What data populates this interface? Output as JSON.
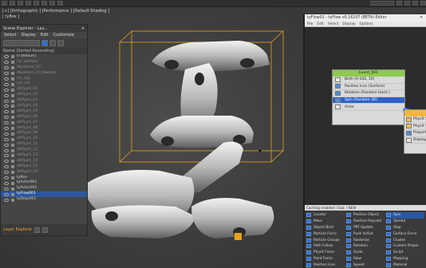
{
  "viewport": {
    "label": "[+] [Orthographic ] [Performance ] [Default Shading ]",
    "sublabel": "[ tyBox ]"
  },
  "scene_explorer": {
    "title": "Scene Explorer - Lay...",
    "menu": [
      "Select",
      "Display",
      "Edit",
      "Customize"
    ],
    "sort_label": "Name (Sorted Ascending)",
    "items": [
      {
        "label": "0 (default)",
        "state": "normal"
      },
      {
        "label": "car_bottom",
        "state": "dim"
      },
      {
        "label": "dbytelom_03",
        "state": "dim"
      },
      {
        "label": "dbytelom_03_blanket",
        "state": "dim"
      },
      {
        "label": "car_top",
        "state": "dim"
      },
      {
        "label": "car_obj",
        "state": "dim"
      },
      {
        "label": "dbflyprt_01",
        "state": "dim"
      },
      {
        "label": "dbflyprt_02",
        "state": "dim"
      },
      {
        "label": "dbflyprt_03",
        "state": "dim"
      },
      {
        "label": "dbflyprt_04",
        "state": "dim"
      },
      {
        "label": "dbflyprt_05",
        "state": "dim"
      },
      {
        "label": "dbflyprt_06",
        "state": "dim"
      },
      {
        "label": "dbflyprt_07",
        "state": "dim"
      },
      {
        "label": "dbflyprt_08",
        "state": "dim"
      },
      {
        "label": "dbflyprt_09",
        "state": "dim"
      },
      {
        "label": "dbflyprt_10",
        "state": "dim"
      },
      {
        "label": "dbflyprt_11",
        "state": "dim"
      },
      {
        "label": "dbflyprt_12",
        "state": "dim"
      },
      {
        "label": "dbflyprt_13",
        "state": "dim"
      },
      {
        "label": "dbflyprt_14",
        "state": "dim"
      },
      {
        "label": "dbflyprt_15",
        "state": "dim"
      },
      {
        "label": "dbflyprt_16",
        "state": "dim"
      },
      {
        "label": "tyBox",
        "state": "normal"
      },
      {
        "label": "tyActor001",
        "state": "normal"
      },
      {
        "label": "tyActor002",
        "state": "normal"
      },
      {
        "label": "tyFlow001",
        "state": "sel"
      },
      {
        "label": "tyDepot01",
        "state": "normal"
      }
    ],
    "layer_label": "Layer Explorer"
  },
  "particle_view": {
    "title": "tyFlow01 - tyFlow v0.16107 (BETA) Editor",
    "menu": [
      "File",
      "Edit",
      "Select",
      "Display",
      "Options"
    ],
    "event1": {
      "title": "Event_001",
      "ops": [
        {
          "label": "Birth (0-100, 10)",
          "color": "#e8e8e8",
          "selected": false
        },
        {
          "label": "Position Icon (Surface)",
          "color": "#4c8ee0",
          "selected": false
        },
        {
          "label": "Rotation (Random Horiz.)",
          "color": "#4c8ee0",
          "selected": false
        },
        {
          "label": "Spin (Random 3D)",
          "color": "#4c8ee0",
          "selected": true
        },
        {
          "label": "Actor",
          "color": "#e8e8e8",
          "selected": false
        }
      ]
    },
    "event2": {
      "ops": [
        {
          "label": "PhysX S",
          "color": "#f3c24f"
        },
        {
          "label": "PhysX Sh",
          "color": "#f3c24f"
        },
        {
          "label": "Propert",
          "color": "#4c8ee0"
        },
        {
          "label": "Display",
          "color": "#e8e8e8"
        }
      ]
    },
    "bar_label": "Caching enabled  |  Sub. / NEW",
    "depot": [
      {
        "label": "Locator",
        "sel": false
      },
      {
        "label": "Position Object",
        "sel": false
      },
      {
        "label": "Spin",
        "sel": true
      },
      {
        "label": "Mass",
        "sel": false
      },
      {
        "label": "Position Raycast",
        "sel": false
      },
      {
        "label": "Spread",
        "sel": false
      },
      {
        "label": "Object Bind",
        "sel": false
      },
      {
        "label": "PRT Update",
        "sel": false
      },
      {
        "label": "Stop",
        "sel": false
      },
      {
        "label": "Particle Force",
        "sel": false
      },
      {
        "label": "Push In/Out",
        "sel": false
      },
      {
        "label": "Surface Force",
        "sel": false
      },
      {
        "label": "Particle Groups",
        "sel": false
      },
      {
        "label": "Rasterize",
        "sel": false
      },
      {
        "label": "Cluster",
        "sel": false
      },
      {
        "label": "Path Follow",
        "sel": false
      },
      {
        "label": "Rotation",
        "sel": false
      },
      {
        "label": "Custom Proper",
        "sel": false
      },
      {
        "label": "PhysX Force",
        "sel": false
      },
      {
        "label": "Scale",
        "sel": false
      },
      {
        "label": "Script",
        "sel": false
      },
      {
        "label": "Point Force",
        "sel": false
      },
      {
        "label": "Slow",
        "sel": false
      },
      {
        "label": "Mapping",
        "sel": false
      },
      {
        "label": "Position Icon",
        "sel": false
      },
      {
        "label": "Speed",
        "sel": false
      },
      {
        "label": "Material",
        "sel": false
      }
    ]
  },
  "colors": {
    "selection_blue": "#2b58a0",
    "event_head_green": "#8ecb4f",
    "bounding_box_orange": "#e8a21c",
    "wire_blue": "#3b7dff"
  }
}
